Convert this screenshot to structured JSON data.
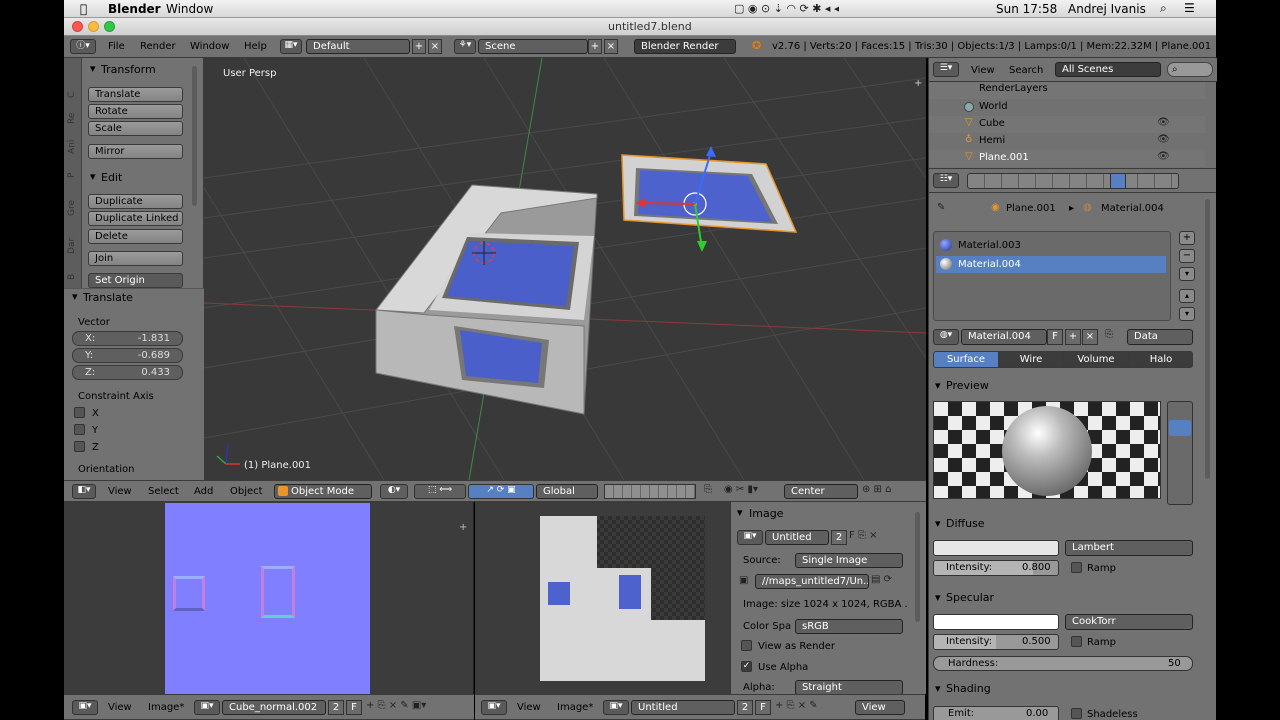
{
  "mac_menubar": {
    "apple": "",
    "app": "Blender",
    "menu": "Window",
    "status": {
      "flag": "🇺🇸",
      "time": "Sun 17:58",
      "user": "Andrej Ivanis"
    }
  },
  "window": {
    "title": "untitled7.blend"
  },
  "info_header": {
    "menus": [
      "File",
      "Render",
      "Window",
      "Help"
    ],
    "layout": "Default",
    "scene": "Scene",
    "engine": "Blender Render",
    "stats": "v2.76 | Verts:20 | Faces:15 | Tris:30 | Objects:1/3 | Lamps:0/1 | Mem:22.32M | Plane.001"
  },
  "toolshelf": {
    "tabs": [
      "C",
      "Re",
      "Ani",
      "P",
      "Gre",
      "Dar",
      "B"
    ],
    "transform_title": "Transform",
    "transform_buttons": [
      "Translate",
      "Rotate",
      "Scale"
    ],
    "mirror": "Mirror",
    "edit_title": "Edit",
    "edit_buttons": [
      "Duplicate",
      "Duplicate Linked",
      "Delete"
    ],
    "join": "Join",
    "set_origin": "Set Origin"
  },
  "operator": {
    "title": "Translate",
    "vector_label": "Vector",
    "x": {
      "label": "X:",
      "value": "-1.831"
    },
    "y": {
      "label": "Y:",
      "value": "-0.689"
    },
    "z": {
      "label": "Z:",
      "value": "0.433"
    },
    "constraint_label": "Constraint Axis",
    "axes": [
      "X",
      "Y",
      "Z"
    ],
    "orientation": "Orientation"
  },
  "viewport": {
    "label": "User Persp",
    "selected": "(1) Plane.001"
  },
  "view3d_header": {
    "menus": [
      "View",
      "Select",
      "Add",
      "Object"
    ],
    "mode": "Object Mode",
    "orientation": "Global",
    "pivot": "Center"
  },
  "outliner": {
    "view": "View",
    "search": "Search",
    "filter": "All Scenes",
    "items": [
      {
        "name": "RenderLayers"
      },
      {
        "name": "World"
      },
      {
        "name": "Cube"
      },
      {
        "name": "Hemi"
      },
      {
        "name": "Plane.001"
      }
    ]
  },
  "properties": {
    "breadcrumb": {
      "object": "Plane.001",
      "material": "Material.004"
    },
    "slots": [
      "Material.003",
      "Material.004"
    ],
    "material_name": "Material.004",
    "f_label": "F",
    "link": "Data",
    "tabs": [
      "Surface",
      "Wire",
      "Volume",
      "Halo"
    ],
    "preview_title": "Preview",
    "diffuse_title": "Diffuse",
    "diffuse_shader": "Lambert",
    "intensity_label": "Intensity:",
    "diffuse_intensity": "0.800",
    "ramp": "Ramp",
    "specular_title": "Specular",
    "specular_shader": "CookTorr",
    "specular_intensity": "0.500",
    "hardness_label": "Hardness:",
    "hardness": "50",
    "shading_title": "Shading",
    "emit_label": "Emit:",
    "emit_value": "0.00",
    "shadeless": "Shadeless"
  },
  "image_editor_left": {
    "menus": [
      "View",
      "Image*"
    ],
    "image": "Cube_normal.002",
    "users": "2",
    "f": "F"
  },
  "image_editor_right": {
    "menus": [
      "View",
      "Image*"
    ],
    "image": "Untitled",
    "users": "2",
    "f": "F",
    "view_menu": "View"
  },
  "image_panel": {
    "title": "Image",
    "name": "Untitled",
    "users": "2",
    "source_label": "Source:",
    "source": "Single Image",
    "path": "//maps_untitled7/Un...",
    "info": "Image: size 1024 x 1024, RGBA ...",
    "colorspace_label": "Color Spa",
    "colorspace": "sRGB",
    "view_as_render": "View as Render",
    "use_alpha": "Use Alpha",
    "alpha_label": "Alpha:",
    "alpha": "Straight"
  },
  "colors": {
    "accent_blue": "#5680c2",
    "normal_map": "#7f7fff",
    "panel": "#727272"
  }
}
